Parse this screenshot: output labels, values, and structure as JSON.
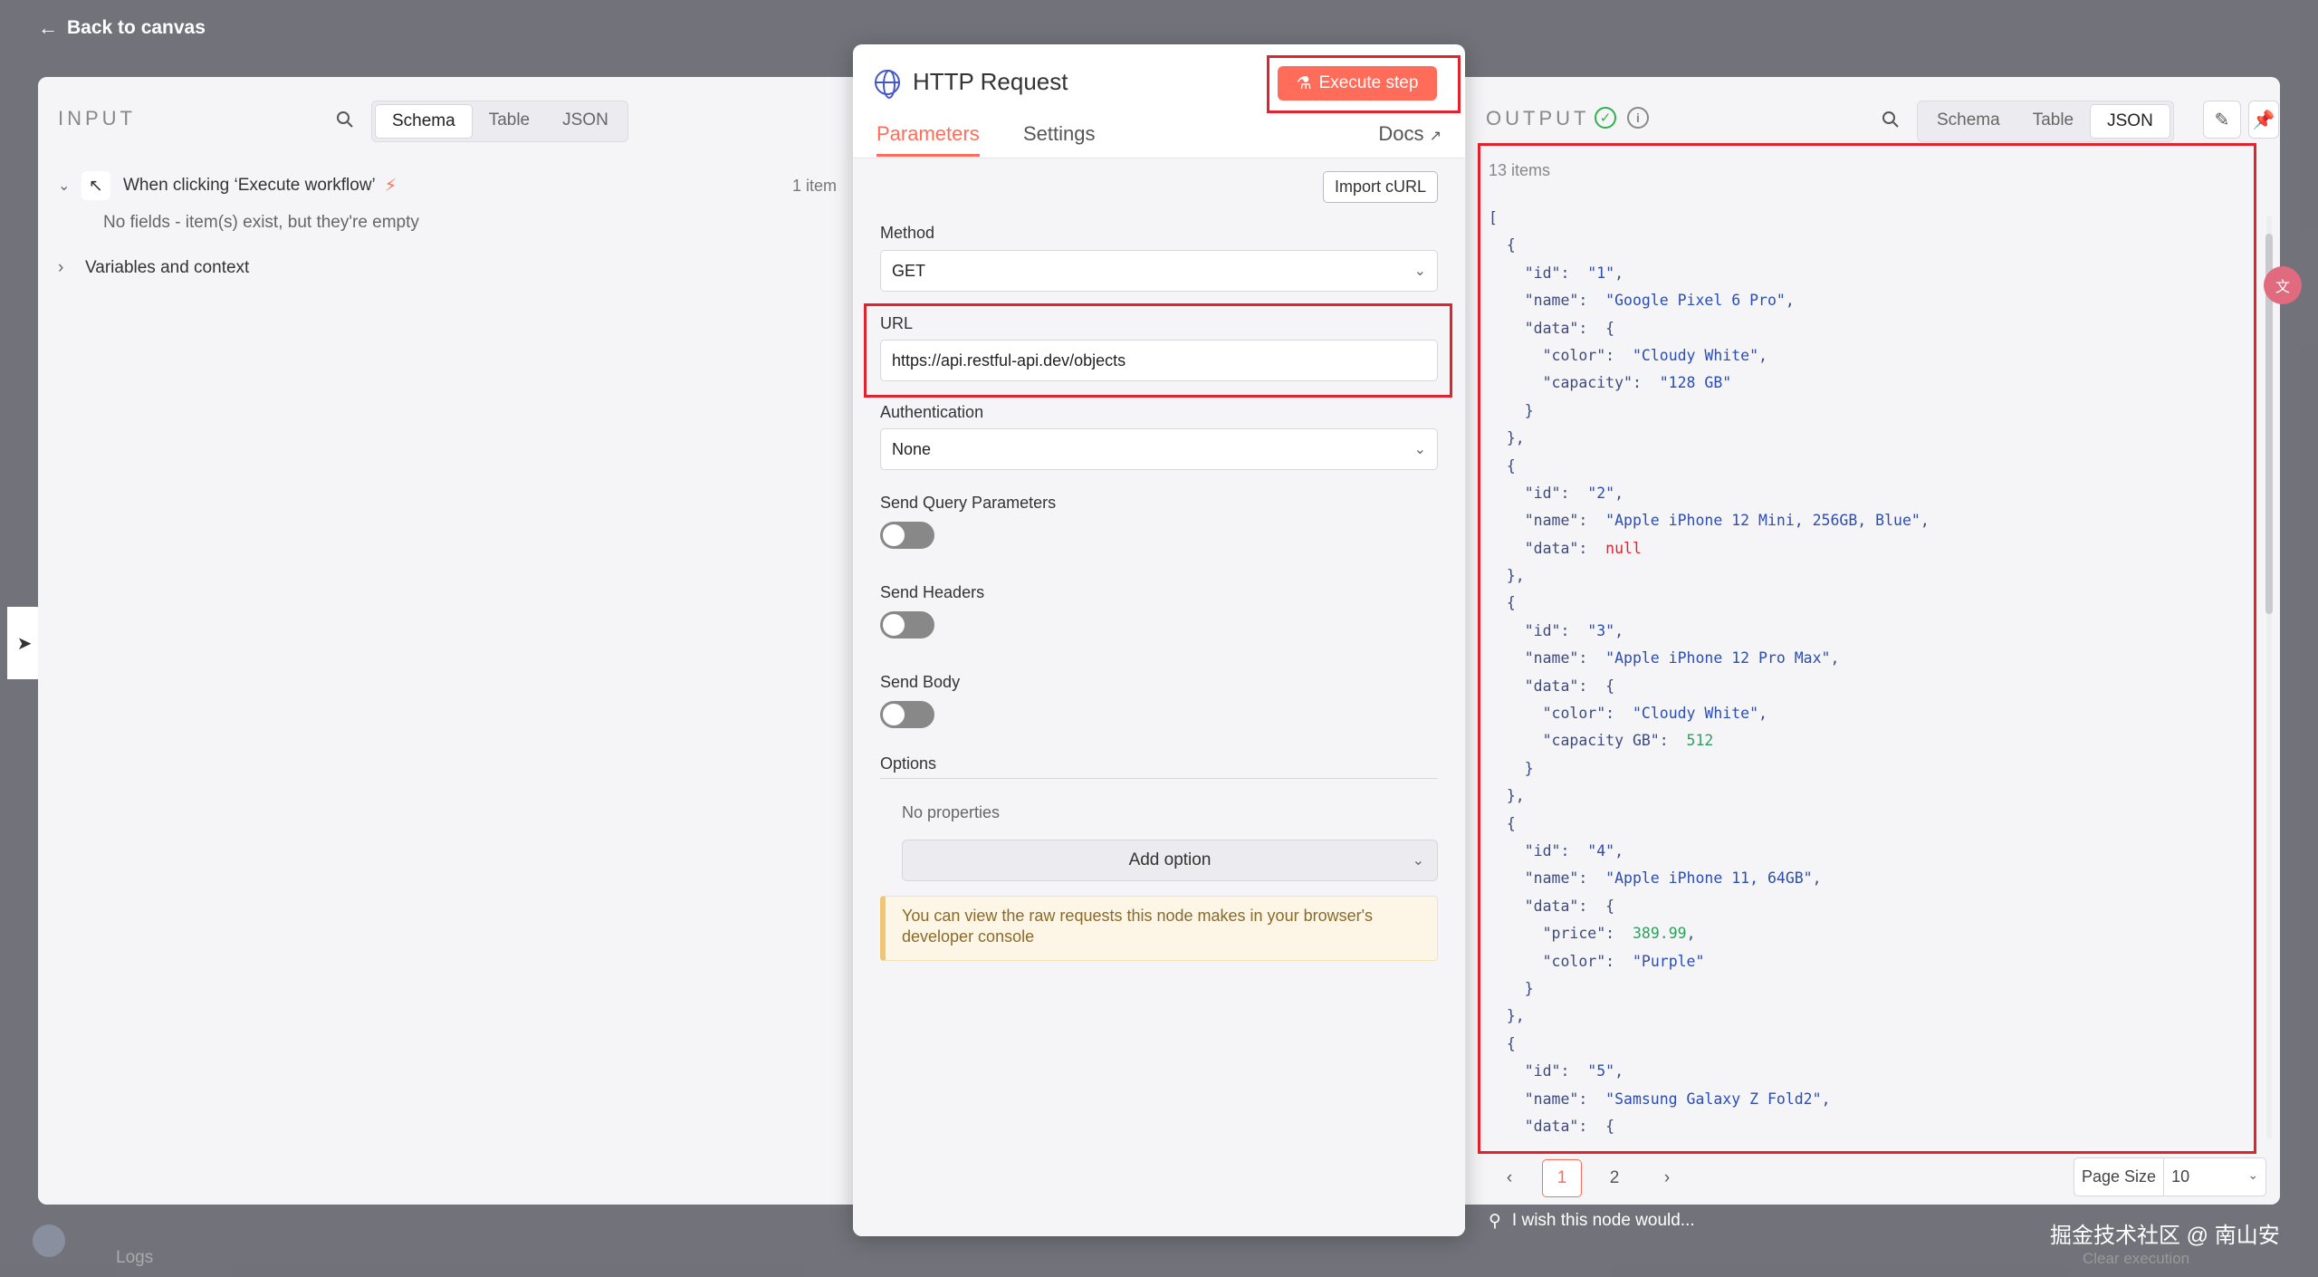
{
  "nav": {
    "back_label": "Back to canvas",
    "logs_label": "Logs",
    "clear_execution": "Clear execution"
  },
  "watermark": "掘金技术社区 @ 南山安",
  "input": {
    "title": "INPUT",
    "view_tabs": [
      "Schema",
      "Table",
      "JSON"
    ],
    "active_view": "Schema",
    "trigger_label": "When clicking ‘Execute workflow’",
    "trigger_count": "1 item",
    "empty_note": "No fields - item(s) exist, but they're empty",
    "variables_label": "Variables and context"
  },
  "node": {
    "title": "HTTP Request",
    "execute_label": "Execute step",
    "tabs": {
      "parameters": "Parameters",
      "settings": "Settings"
    },
    "docs_label": "Docs",
    "import_curl": "Import cURL",
    "method_label": "Method",
    "method_value": "GET",
    "url_label": "URL",
    "url_value": "https://api.restful-api.dev/objects",
    "auth_label": "Authentication",
    "auth_value": "None",
    "send_query_label": "Send Query Parameters",
    "send_headers_label": "Send Headers",
    "send_body_label": "Send Body",
    "options_label": "Options",
    "no_properties": "No properties",
    "add_option": "Add option",
    "notice_line1": "You can view the raw requests this node makes in your browser's",
    "notice_line2": "developer console"
  },
  "output": {
    "title": "OUTPUT",
    "view_tabs": [
      "Schema",
      "Table",
      "JSON"
    ],
    "active_view": "JSON",
    "items_count": "13 items",
    "json_lines": [
      "[",
      "  {",
      "    \"id\":  \"1\",",
      "    \"name\":  \"Google Pixel 6 Pro\",",
      "    \"data\":  {",
      "      \"color\":  \"Cloudy White\",",
      "      \"capacity\":  \"128 GB\"",
      "    }",
      "  },",
      "  {",
      "    \"id\":  \"2\",",
      "    \"name\":  \"Apple iPhone 12 Mini, 256GB, Blue\",",
      "    \"data\":  null",
      "  },",
      "  {",
      "    \"id\":  \"3\",",
      "    \"name\":  \"Apple iPhone 12 Pro Max\",",
      "    \"data\":  {",
      "      \"color\":  \"Cloudy White\",",
      "      \"capacity GB\":  512",
      "    }",
      "  },",
      "  {",
      "    \"id\":  \"4\",",
      "    \"name\":  \"Apple iPhone 11, 64GB\",",
      "    \"data\":  {",
      "      \"price\":  389.99,",
      "      \"color\":  \"Purple\"",
      "    }",
      "  },",
      "  {",
      "    \"id\":  \"5\",",
      "    \"name\":  \"Samsung Galaxy Z Fold2\",",
      "    \"data\":  {"
    ],
    "pages": [
      "1",
      "2"
    ],
    "current_page": "1",
    "page_size_label": "Page Size",
    "page_size_value": "10",
    "wish_label": "I wish this node would..."
  },
  "colors": {
    "accent": "#ff6d5a",
    "highlight_frame": "#e0242f",
    "success": "#2fb14f"
  }
}
